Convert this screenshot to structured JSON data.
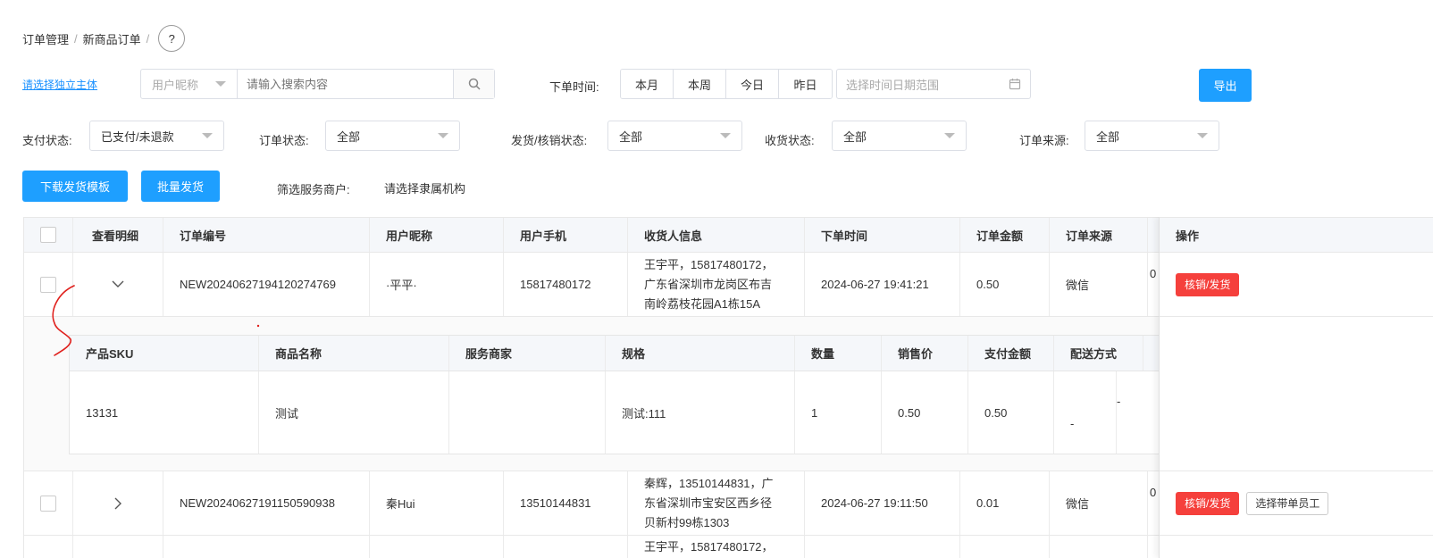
{
  "breadcrumb": {
    "items": [
      "订单管理",
      "新商品订单"
    ],
    "separator": "/",
    "help": "?"
  },
  "filters": {
    "entity_link": "请选择独立主体",
    "search_type": "用户昵称",
    "search_placeholder": "请输入搜索内容",
    "order_time_label": "下单时间:",
    "time_buttons": [
      "本月",
      "本周",
      "今日",
      "昨日"
    ],
    "date_range_placeholder": "选择时间日期范围",
    "export": "导出",
    "pay_status_label": "支付状态:",
    "pay_status_value": "已支付/未退款",
    "order_status_label": "订单状态:",
    "order_status_value": "全部",
    "ship_status_label": "发货/核销状态:",
    "ship_status_value": "全部",
    "receive_status_label": "收货状态:",
    "receive_status_value": "全部",
    "source_label": "订单来源:",
    "source_value": "全部"
  },
  "actions": {
    "download_template": "下载发货模板",
    "batch_ship": "批量发货",
    "merchant_filter_label": "筛选服务商户:",
    "merchant_filter_link": "请选择隶属机构"
  },
  "table": {
    "headers": [
      "查看明细",
      "订单编号",
      "用户昵称",
      "用户手机",
      "收货人信息",
      "下单时间",
      "订单金额",
      "订单来源",
      "操作"
    ],
    "rows": [
      {
        "order_no": "NEW20240627194120274769",
        "nickname": "·平平·",
        "phone": "15817480172",
        "receiver": [
          "王宇平，15817480172，",
          "广东省深圳市龙岗区布吉",
          "南岭荔枝花园A1栋15A"
        ],
        "time": "2024-06-27 19:41:21",
        "amount": "0.50",
        "source": "微信",
        "extra": "0",
        "action": "核销/发货"
      },
      {
        "order_no": "NEW20240627191150590938",
        "nickname": "秦Hui",
        "phone": "13510144831",
        "receiver": [
          "秦辉，13510144831，广",
          "东省深圳市宝安区西乡径",
          "贝新村99栋1303"
        ],
        "time": "2024-06-27 19:11:50",
        "amount": "0.01",
        "source": "微信",
        "extra": "0",
        "action": "核销/发货",
        "action2": "选择带单员工"
      },
      {
        "receiver_partial": "王宇平，15817480172，"
      }
    ]
  },
  "sub_table": {
    "headers": [
      "产品SKU",
      "商品名称",
      "服务商家",
      "规格",
      "数量",
      "销售价",
      "支付金额",
      "配送方式"
    ],
    "row": {
      "sku": "13131",
      "name": "测试",
      "merchant": "",
      "spec": "测试:111",
      "qty": "1",
      "price": "0.50",
      "paid": "0.50",
      "delivery": "-",
      "extra": "-"
    }
  },
  "colors": {
    "primary": "#1e9fff",
    "danger": "#f5403c",
    "annotation": "#e0201c"
  }
}
